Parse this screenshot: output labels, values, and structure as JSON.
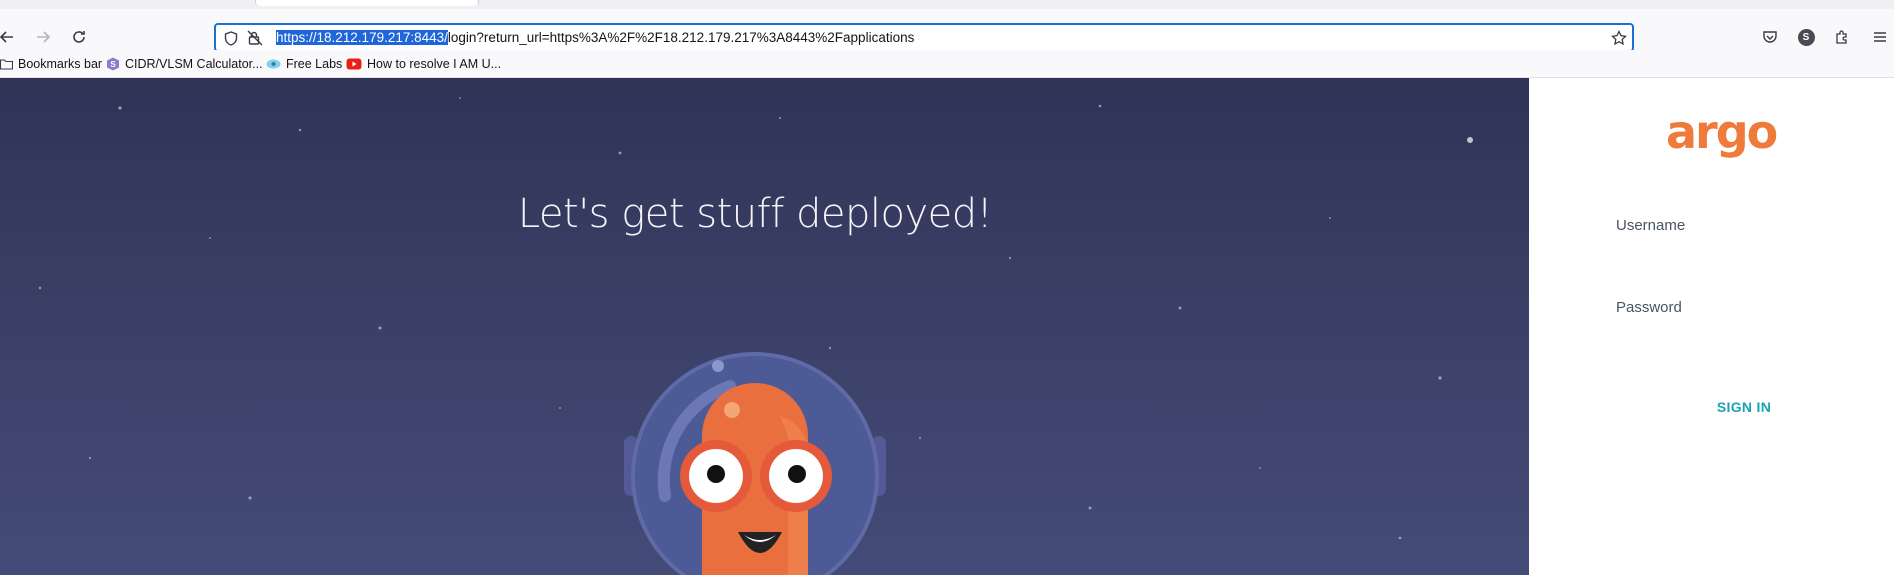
{
  "browser": {
    "url_selected": "https://18.212.179.217:8443/",
    "url_rest": "login?return_url=https%3A%2F%2F18.212.179.217%3A8443%2Fapplications",
    "profile_initial": "S"
  },
  "bookmarks": [
    {
      "label": "Bookmarks bar",
      "icon": "folder-icon"
    },
    {
      "label": "CIDR/VLSM Calculator...",
      "icon": "calculator-favicon"
    },
    {
      "label": "Free Labs",
      "icon": "labs-favicon"
    },
    {
      "label": "How to resolve I AM U...",
      "icon": "youtube-favicon"
    }
  ],
  "hero": {
    "tagline": "Let's get stuff deployed!"
  },
  "login": {
    "logo": "argo",
    "username_label": "Username",
    "password_label": "Password",
    "signin_label": "SIGN IN"
  },
  "colors": {
    "brand_orange": "#ef7b3a",
    "signin_teal": "#1aa3b5",
    "hero_bg": "#3a3f66",
    "url_selection": "#1f66d9"
  }
}
